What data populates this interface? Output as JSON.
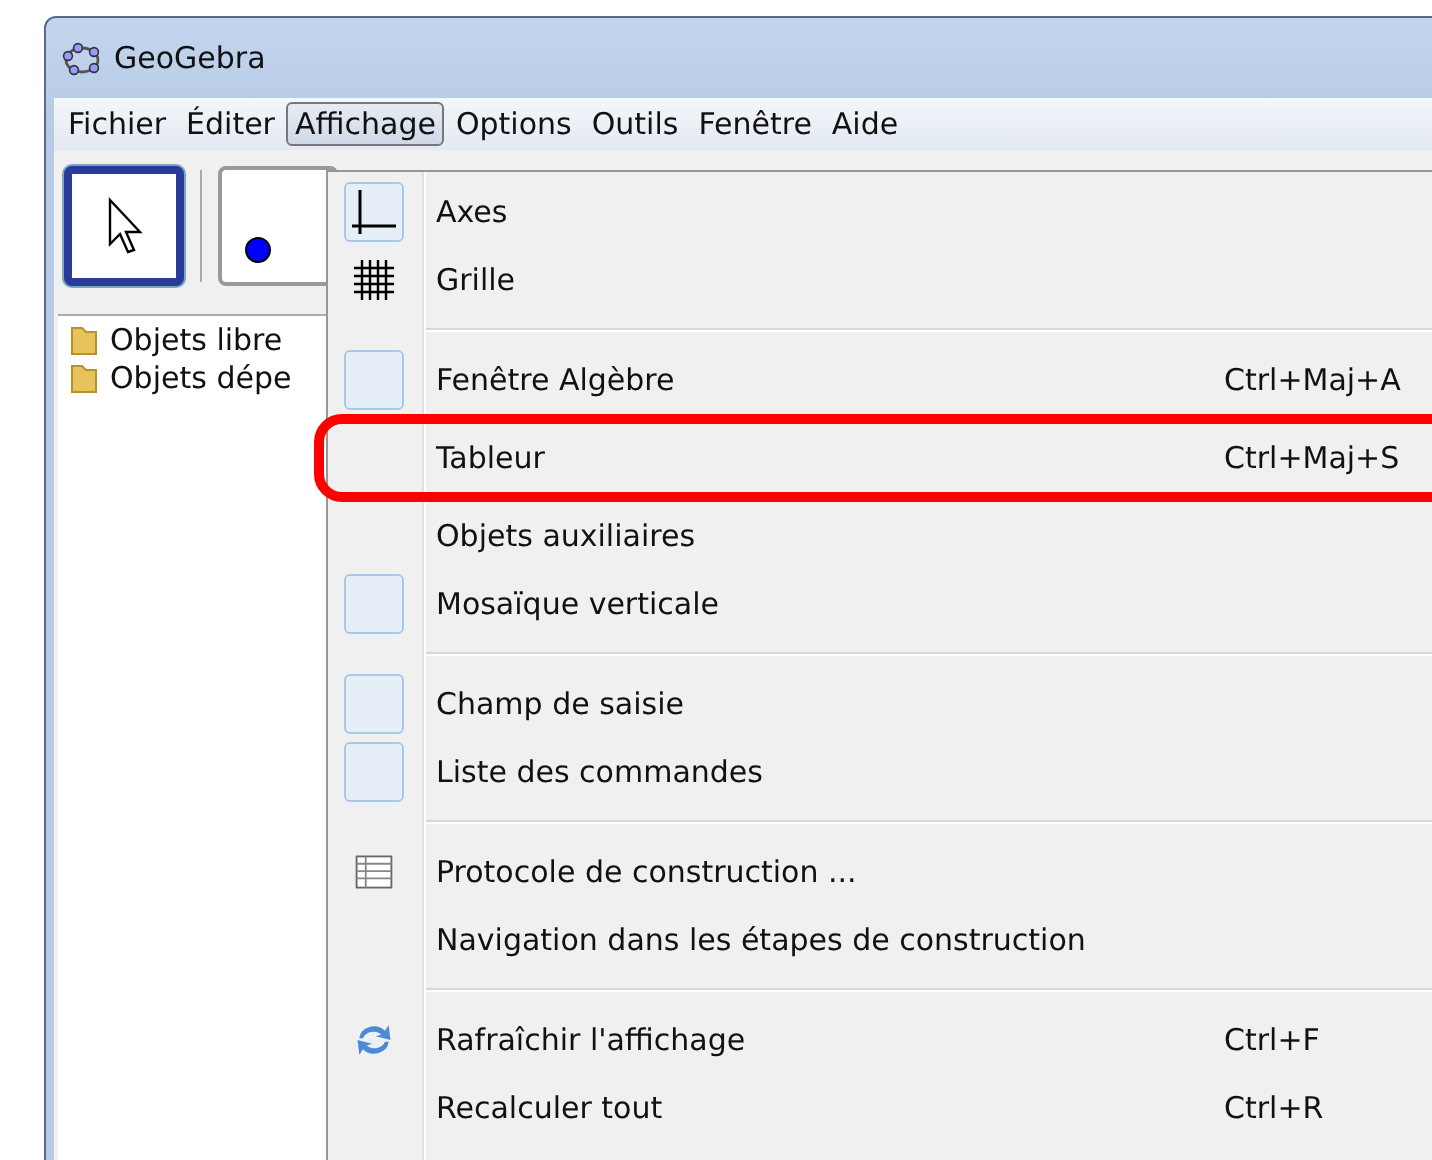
{
  "window": {
    "title": "GeoGebra"
  },
  "menubar": [
    {
      "label": "Fichier",
      "selected": false
    },
    {
      "label": "Éditer",
      "selected": false
    },
    {
      "label": "Affichage",
      "selected": true
    },
    {
      "label": "Options",
      "selected": false
    },
    {
      "label": "Outils",
      "selected": false
    },
    {
      "label": "Fenêtre",
      "selected": false
    },
    {
      "label": "Aide",
      "selected": false
    }
  ],
  "toolbar": [
    {
      "kind": "move",
      "selected": true
    },
    {
      "kind": "point",
      "selected": false
    }
  ],
  "tree": [
    {
      "label": "Objets libre"
    },
    {
      "label": "Objets dépe"
    }
  ],
  "menu": {
    "groups": [
      [
        {
          "kind": "axes",
          "label": "Axes",
          "framed": true
        },
        {
          "kind": "grid",
          "label": "Grille",
          "framed": false
        }
      ],
      [
        {
          "kind": "none",
          "label": "Fenêtre Algèbre",
          "shortcut": "Ctrl+Maj+A",
          "framed": true
        },
        {
          "kind": "none",
          "label": "Tableur",
          "shortcut": "Ctrl+Maj+S",
          "framed": false,
          "highlighted": true
        },
        {
          "kind": "none",
          "label": "Objets auxiliaires",
          "framed": false
        },
        {
          "kind": "none",
          "label": "Mosaïque verticale",
          "framed": true
        }
      ],
      [
        {
          "kind": "none",
          "label": "Champ de saisie",
          "framed": true
        },
        {
          "kind": "none",
          "label": "Liste des commandes",
          "framed": true
        }
      ],
      [
        {
          "kind": "table",
          "label": "Protocole de construction ...",
          "framed": false
        },
        {
          "kind": "none",
          "label": "Navigation dans les étapes de construction",
          "framed": false
        }
      ],
      [
        {
          "kind": "refresh",
          "label": "Rafraîchir l'affichage",
          "shortcut": "Ctrl+F",
          "framed": false
        },
        {
          "kind": "none",
          "label": "Recalculer tout",
          "shortcut": "Ctrl+R",
          "framed": false
        }
      ]
    ]
  }
}
